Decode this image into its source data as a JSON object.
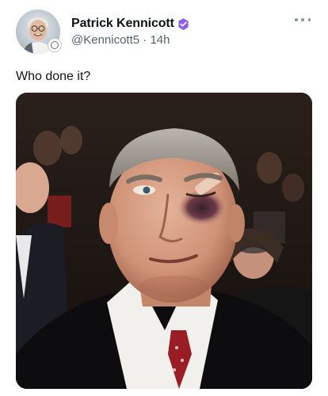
{
  "post": {
    "author": {
      "display_name": "Patrick Kennicott",
      "handle": "@Kennicott5",
      "separator": "·",
      "time_ago": "14h",
      "verified_badge_color": "#8b5cf6",
      "avatar_icon": "profile-photo"
    },
    "text": "Who done it?",
    "menu_icon": "more-dots-icon",
    "media": {
      "type": "photo",
      "icon": "photo-image"
    }
  },
  "colors": {
    "name": "#0f1419",
    "secondary": "#536471",
    "verified": "#8b5cf6"
  }
}
